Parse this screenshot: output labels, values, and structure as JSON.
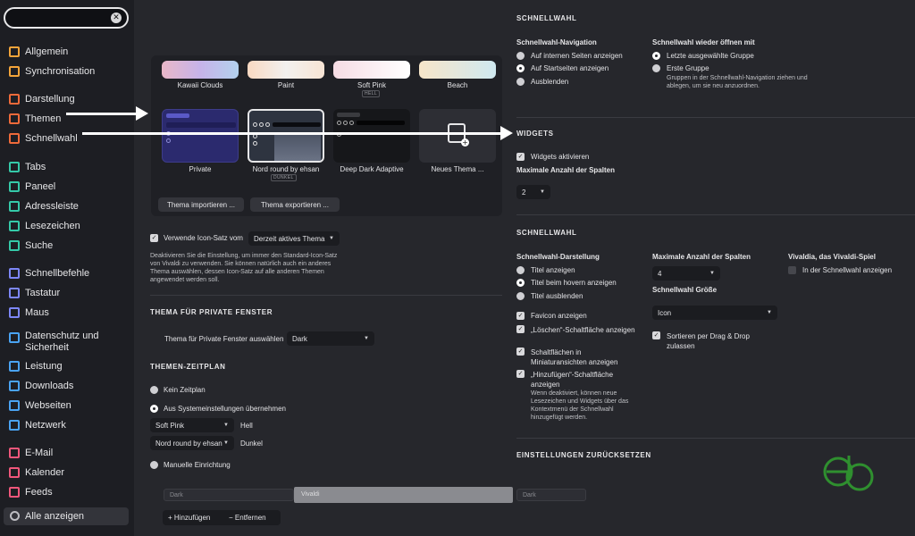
{
  "search": {
    "value": "",
    "placeholder": ""
  },
  "sidebar": {
    "groups": [
      [
        {
          "label": "Allgemein",
          "icon": "general-icon",
          "color": "#f3a43a"
        },
        {
          "label": "Synchronisation",
          "icon": "cloud-icon",
          "color": "#f3a43a"
        }
      ],
      [
        {
          "label": "Darstellung",
          "icon": "appearance-icon",
          "color": "#ee6a3a"
        },
        {
          "label": "Themen",
          "icon": "brush-icon",
          "color": "#ee6a3a"
        },
        {
          "label": "Schnellwahl",
          "icon": "speed-dial-icon",
          "color": "#ee6a3a"
        }
      ],
      [
        {
          "label": "Tabs",
          "icon": "tabs-icon",
          "color": "#35c9a8"
        },
        {
          "label": "Paneel",
          "icon": "panel-icon",
          "color": "#35c9a8"
        },
        {
          "label": "Adressleiste",
          "icon": "address-bar-icon",
          "color": "#35c9a8"
        },
        {
          "label": "Lesezeichen",
          "icon": "bookmark-icon",
          "color": "#35c9a8"
        },
        {
          "label": "Suche",
          "icon": "search-icon",
          "color": "#35c9a8"
        }
      ],
      [
        {
          "label": "Schnellbefehle",
          "icon": "commands-icon",
          "color": "#7d87f7"
        },
        {
          "label": "Tastatur",
          "icon": "keyboard-icon",
          "color": "#7d87f7"
        },
        {
          "label": "Maus",
          "icon": "mouse-icon",
          "color": "#7d87f7"
        }
      ],
      [
        {
          "label": "Datenschutz und Sicherheit",
          "icon": "shield-icon",
          "color": "#4aa3f2"
        },
        {
          "label": "Leistung",
          "icon": "gauge-icon",
          "color": "#4aa3f2"
        },
        {
          "label": "Downloads",
          "icon": "download-icon",
          "color": "#4aa3f2"
        },
        {
          "label": "Webseiten",
          "icon": "globe-icon",
          "color": "#4aa3f2"
        },
        {
          "label": "Netzwerk",
          "icon": "network-icon",
          "color": "#4aa3f2"
        }
      ],
      [
        {
          "label": "E-Mail",
          "icon": "mail-icon",
          "color": "#f0577b"
        },
        {
          "label": "Kalender",
          "icon": "calendar-icon",
          "color": "#f0577b"
        },
        {
          "label": "Feeds",
          "icon": "feed-icon",
          "color": "#f0577b"
        }
      ]
    ],
    "all": "Alle anzeigen"
  },
  "themes": {
    "top_row": [
      {
        "name": "Kawaii Clouds"
      },
      {
        "name": "Paint"
      },
      {
        "name": "Soft Pink",
        "badge": "HELL"
      },
      {
        "name": "Beach"
      }
    ],
    "bottom_row": [
      {
        "name": "Private"
      },
      {
        "name": "Nord round by ehsan",
        "badge": "DUNKEL"
      },
      {
        "name": "Deep Dark Adaptive"
      },
      {
        "name": "Neues Thema ..."
      }
    ],
    "import_btn": "Thema importieren ...",
    "export_btn": "Thema exportieren ...",
    "icon_set_label": "Verwende Icon-Satz vom",
    "icon_set_value": "Derzeit aktives Thema",
    "icon_set_desc": "Deaktivieren Sie die Einstellung, um immer den Standard-Icon-Satz von Vivaldi zu verwenden. Sie können natürlich auch ein anderes Thema auswählen, dessen Icon-Satz auf alle anderen Themen angewendet werden soll."
  },
  "private_theme": {
    "heading": "THEMA FÜR PRIVATE FENSTER",
    "label": "Thema für Private Fenster auswählen",
    "value": "Dark"
  },
  "schedule": {
    "heading": "THEMEN-ZEITPLAN",
    "none": "Kein Zeitplan",
    "system": "Aus Systemeinstellungen übernehmen",
    "light_value": "Soft Pink",
    "light_label": "Hell",
    "dark_value": "Nord round by ehsan",
    "dark_label": "Dunkel",
    "manual": "Manuelle Einrichtung",
    "timeline": [
      "Dark",
      "Vivaldi",
      "Dark"
    ],
    "add": "Hinzufügen",
    "remove": "Entfernen"
  },
  "right": {
    "speed_dial_heading": "SCHNELLWAHL",
    "nav_heading": "Schnellwahl-Navigation",
    "nav_opts": [
      "Auf internen Seiten anzeigen",
      "Auf Startseiten anzeigen",
      "Ausblenden"
    ],
    "reopen_heading": "Schnellwahl wieder öffnen mit",
    "reopen_opts": [
      "Letzte ausgewählte Gruppe",
      "Erste Gruppe"
    ],
    "reopen_desc": "Gruppen in der Schnellwahl-Navigation ziehen und ablegen, um sie neu anzuordnen.",
    "widgets_heading": "WIDGETS",
    "widgets_enable": "Widgets aktivieren",
    "widgets_cols_label": "Maximale Anzahl der Spalten",
    "widgets_cols_value": "2",
    "sd_heading": "SCHNELLWAHL",
    "display_heading": "Schnellwahl-Darstellung",
    "display_opts": [
      "Titel anzeigen",
      "Titel beim hovern anzeigen",
      "Titel ausblenden"
    ],
    "cb_favicon": "Favicon anzeigen",
    "cb_delete": "„Löschen“-Schaltfläche anzeigen",
    "cb_thumbs": "Schaltflächen in Miniaturansichten anzeigen",
    "cb_add": "„Hinzufügen“-Schaltfläche anzeigen",
    "cb_add_desc": "Wenn deaktiviert, können neue Lesezeichen und Widgets über das Kontextmenü der Schnellwahl hinzugefügt werden.",
    "cols_label": "Maximale Anzahl der Spalten",
    "cols_value": "4",
    "size_label": "Schnellwahl Größe",
    "size_value": "Icon",
    "sort_label": "Sortieren per Drag & Drop zulassen",
    "game_heading": "Vivaldia, das Vivaldi-Spiel",
    "game_label": "In der Schnellwahl anzeigen",
    "reset_heading": "EINSTELLUNGEN ZURÜCKSETZEN"
  },
  "watermark": {
    "color": "#2f8f2f"
  }
}
